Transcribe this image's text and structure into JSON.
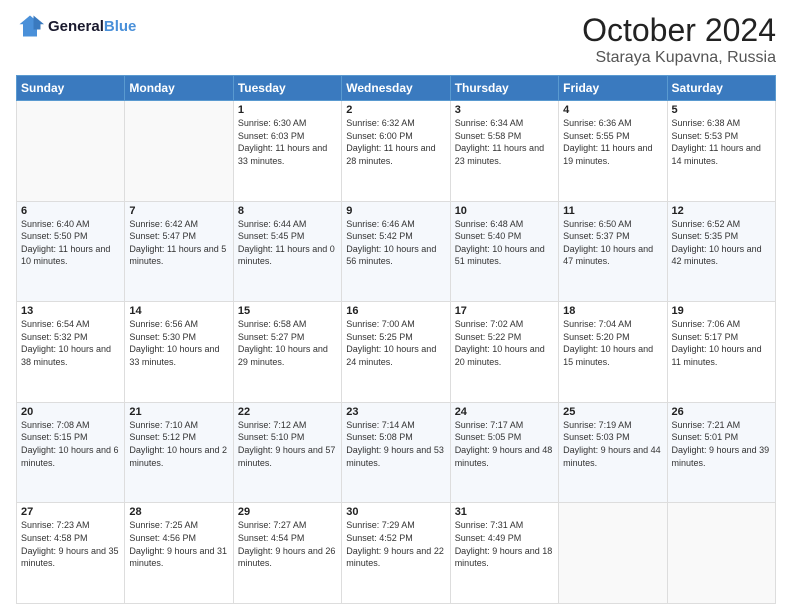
{
  "header": {
    "logo_line1": "General",
    "logo_line2": "Blue",
    "month": "October 2024",
    "location": "Staraya Kupavna, Russia"
  },
  "days_of_week": [
    "Sunday",
    "Monday",
    "Tuesday",
    "Wednesday",
    "Thursday",
    "Friday",
    "Saturday"
  ],
  "weeks": [
    [
      {
        "day": "",
        "sunrise": "",
        "sunset": "",
        "daylight": ""
      },
      {
        "day": "",
        "sunrise": "",
        "sunset": "",
        "daylight": ""
      },
      {
        "day": "1",
        "sunrise": "Sunrise: 6:30 AM",
        "sunset": "Sunset: 6:03 PM",
        "daylight": "Daylight: 11 hours and 33 minutes."
      },
      {
        "day": "2",
        "sunrise": "Sunrise: 6:32 AM",
        "sunset": "Sunset: 6:00 PM",
        "daylight": "Daylight: 11 hours and 28 minutes."
      },
      {
        "day": "3",
        "sunrise": "Sunrise: 6:34 AM",
        "sunset": "Sunset: 5:58 PM",
        "daylight": "Daylight: 11 hours and 23 minutes."
      },
      {
        "day": "4",
        "sunrise": "Sunrise: 6:36 AM",
        "sunset": "Sunset: 5:55 PM",
        "daylight": "Daylight: 11 hours and 19 minutes."
      },
      {
        "day": "5",
        "sunrise": "Sunrise: 6:38 AM",
        "sunset": "Sunset: 5:53 PM",
        "daylight": "Daylight: 11 hours and 14 minutes."
      }
    ],
    [
      {
        "day": "6",
        "sunrise": "Sunrise: 6:40 AM",
        "sunset": "Sunset: 5:50 PM",
        "daylight": "Daylight: 11 hours and 10 minutes."
      },
      {
        "day": "7",
        "sunrise": "Sunrise: 6:42 AM",
        "sunset": "Sunset: 5:47 PM",
        "daylight": "Daylight: 11 hours and 5 minutes."
      },
      {
        "day": "8",
        "sunrise": "Sunrise: 6:44 AM",
        "sunset": "Sunset: 5:45 PM",
        "daylight": "Daylight: 11 hours and 0 minutes."
      },
      {
        "day": "9",
        "sunrise": "Sunrise: 6:46 AM",
        "sunset": "Sunset: 5:42 PM",
        "daylight": "Daylight: 10 hours and 56 minutes."
      },
      {
        "day": "10",
        "sunrise": "Sunrise: 6:48 AM",
        "sunset": "Sunset: 5:40 PM",
        "daylight": "Daylight: 10 hours and 51 minutes."
      },
      {
        "day": "11",
        "sunrise": "Sunrise: 6:50 AM",
        "sunset": "Sunset: 5:37 PM",
        "daylight": "Daylight: 10 hours and 47 minutes."
      },
      {
        "day": "12",
        "sunrise": "Sunrise: 6:52 AM",
        "sunset": "Sunset: 5:35 PM",
        "daylight": "Daylight: 10 hours and 42 minutes."
      }
    ],
    [
      {
        "day": "13",
        "sunrise": "Sunrise: 6:54 AM",
        "sunset": "Sunset: 5:32 PM",
        "daylight": "Daylight: 10 hours and 38 minutes."
      },
      {
        "day": "14",
        "sunrise": "Sunrise: 6:56 AM",
        "sunset": "Sunset: 5:30 PM",
        "daylight": "Daylight: 10 hours and 33 minutes."
      },
      {
        "day": "15",
        "sunrise": "Sunrise: 6:58 AM",
        "sunset": "Sunset: 5:27 PM",
        "daylight": "Daylight: 10 hours and 29 minutes."
      },
      {
        "day": "16",
        "sunrise": "Sunrise: 7:00 AM",
        "sunset": "Sunset: 5:25 PM",
        "daylight": "Daylight: 10 hours and 24 minutes."
      },
      {
        "day": "17",
        "sunrise": "Sunrise: 7:02 AM",
        "sunset": "Sunset: 5:22 PM",
        "daylight": "Daylight: 10 hours and 20 minutes."
      },
      {
        "day": "18",
        "sunrise": "Sunrise: 7:04 AM",
        "sunset": "Sunset: 5:20 PM",
        "daylight": "Daylight: 10 hours and 15 minutes."
      },
      {
        "day": "19",
        "sunrise": "Sunrise: 7:06 AM",
        "sunset": "Sunset: 5:17 PM",
        "daylight": "Daylight: 10 hours and 11 minutes."
      }
    ],
    [
      {
        "day": "20",
        "sunrise": "Sunrise: 7:08 AM",
        "sunset": "Sunset: 5:15 PM",
        "daylight": "Daylight: 10 hours and 6 minutes."
      },
      {
        "day": "21",
        "sunrise": "Sunrise: 7:10 AM",
        "sunset": "Sunset: 5:12 PM",
        "daylight": "Daylight: 10 hours and 2 minutes."
      },
      {
        "day": "22",
        "sunrise": "Sunrise: 7:12 AM",
        "sunset": "Sunset: 5:10 PM",
        "daylight": "Daylight: 9 hours and 57 minutes."
      },
      {
        "day": "23",
        "sunrise": "Sunrise: 7:14 AM",
        "sunset": "Sunset: 5:08 PM",
        "daylight": "Daylight: 9 hours and 53 minutes."
      },
      {
        "day": "24",
        "sunrise": "Sunrise: 7:17 AM",
        "sunset": "Sunset: 5:05 PM",
        "daylight": "Daylight: 9 hours and 48 minutes."
      },
      {
        "day": "25",
        "sunrise": "Sunrise: 7:19 AM",
        "sunset": "Sunset: 5:03 PM",
        "daylight": "Daylight: 9 hours and 44 minutes."
      },
      {
        "day": "26",
        "sunrise": "Sunrise: 7:21 AM",
        "sunset": "Sunset: 5:01 PM",
        "daylight": "Daylight: 9 hours and 39 minutes."
      }
    ],
    [
      {
        "day": "27",
        "sunrise": "Sunrise: 7:23 AM",
        "sunset": "Sunset: 4:58 PM",
        "daylight": "Daylight: 9 hours and 35 minutes."
      },
      {
        "day": "28",
        "sunrise": "Sunrise: 7:25 AM",
        "sunset": "Sunset: 4:56 PM",
        "daylight": "Daylight: 9 hours and 31 minutes."
      },
      {
        "day": "29",
        "sunrise": "Sunrise: 7:27 AM",
        "sunset": "Sunset: 4:54 PM",
        "daylight": "Daylight: 9 hours and 26 minutes."
      },
      {
        "day": "30",
        "sunrise": "Sunrise: 7:29 AM",
        "sunset": "Sunset: 4:52 PM",
        "daylight": "Daylight: 9 hours and 22 minutes."
      },
      {
        "day": "31",
        "sunrise": "Sunrise: 7:31 AM",
        "sunset": "Sunset: 4:49 PM",
        "daylight": "Daylight: 9 hours and 18 minutes."
      },
      {
        "day": "",
        "sunrise": "",
        "sunset": "",
        "daylight": ""
      },
      {
        "day": "",
        "sunrise": "",
        "sunset": "",
        "daylight": ""
      }
    ]
  ]
}
